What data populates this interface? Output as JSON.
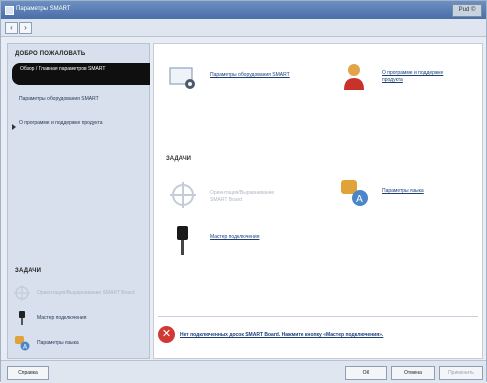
{
  "window": {
    "title": "Параметры SMART",
    "close_label": "Pud ©"
  },
  "nav": {
    "back_label": "‹",
    "forward_label": "›"
  },
  "sidebar": {
    "heading": "ДОБРО ПОЖАЛОВАТЬ",
    "selected_item": "Обзор / Главная параметров SMART",
    "items": [
      {
        "label": "Параметры оборудования SMART"
      },
      {
        "label": "О программе и поддержке продукта"
      }
    ],
    "tasks_heading": "ЗАДАЧИ",
    "tasks": [
      {
        "label": "Ориентация/Выравнивание SMART Board",
        "icon": "crosshair-icon",
        "enabled": false
      },
      {
        "label": "Мастер подключения",
        "icon": "usb-cable-icon",
        "enabled": true
      },
      {
        "label": "Параметры языка",
        "icon": "language-icon",
        "enabled": true
      }
    ]
  },
  "main": {
    "top_items": [
      {
        "label": "Параметры оборудования SMART",
        "icon": "hardware-settings-icon"
      },
      {
        "label": "О программе и поддержке продукта",
        "icon": "support-person-icon"
      }
    ],
    "tasks_heading": "ЗАДАЧИ",
    "task_items": [
      {
        "label": "Ориентация/Выравнивание SMART Board",
        "icon": "crosshair-icon",
        "enabled": false
      },
      {
        "label": "Параметры языка",
        "icon": "language-icon",
        "enabled": true
      },
      {
        "label": "Мастер подключения",
        "icon": "usb-cable-icon",
        "enabled": true
      }
    ],
    "warning_text": "Нет подключенных досок SMART Board. Нажмите кнопку «Мастер подключения»."
  },
  "buttons": {
    "help": "Справка",
    "ok": "ОК",
    "cancel": "Отмена",
    "apply": "Применить"
  },
  "colors": {
    "accent": "#1c3f7a",
    "warning": "#d13a34",
    "selected_bg": "#0f0f0f"
  }
}
